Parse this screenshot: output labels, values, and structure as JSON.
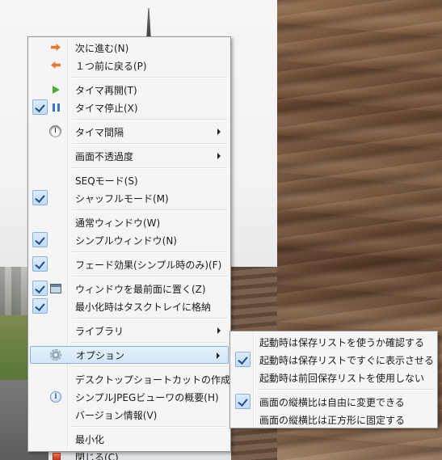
{
  "main_menu": {
    "next": "次に進む(N)",
    "prev": "１つ前に戻る(P)",
    "timer_resume": "タイマ再開(T)",
    "timer_stop": "タイマ停止(X)",
    "timer_interval": "タイマ間隔",
    "opacity": "画面不透過度",
    "seq_mode": "SEQモード(S)",
    "shuffle_mode": "シャッフルモード(M)",
    "normal_window": "通常ウィンドウ(W)",
    "simple_window": "シンプルウィンドウ(N)",
    "fade_effect": "フェード効果(シンプル時のみ)(F)",
    "always_on_top": "ウィンドウを最前面に置く(Z)",
    "minimize_to_tray": "最小化時はタスクトレイに格納",
    "library": "ライブラリ",
    "options": "オプション",
    "create_shortcut": "デスクトップショートカットの作成",
    "about": "シンプルJPEGビューワの概要(H)",
    "version_info": "バージョン情報(V)",
    "minimize": "最小化",
    "close": "閉じる(C)"
  },
  "options_submenu": {
    "confirm_saved_list": "起動時は保存リストを使うか確認する",
    "show_saved_list_immediately": "起動時は保存リストですぐに表示させる",
    "no_previous_list": "起動時は前回保存リストを使用しない",
    "aspect_free": "画面の縦横比は自由に変更できる",
    "aspect_square": "画面の縦横比は正方形に固定する"
  },
  "checked": {
    "timer_stop": true,
    "shuffle_mode": true,
    "simple_window": true,
    "fade_effect": true,
    "always_on_top": true,
    "minimize_to_tray": true,
    "show_saved_list_immediately": true,
    "aspect_free": true
  },
  "icons": {
    "next": "arrow-right-icon",
    "prev": "arrow-left-icon",
    "timer_resume": "play-icon",
    "timer_stop": "pause-icon",
    "timer_interval": "stopwatch-icon",
    "always_on_top": "window-icon",
    "options": "gear-icon",
    "about": "info-icon",
    "close": "stop-icon"
  },
  "colors": {
    "menu_bg": "#f5f5f5",
    "highlight_border": "#84b3e4",
    "arrow_orange": "#e9772e",
    "play_green": "#4caf2f",
    "pause_blue": "#3c72c4",
    "stop_red": "#c8341a"
  }
}
